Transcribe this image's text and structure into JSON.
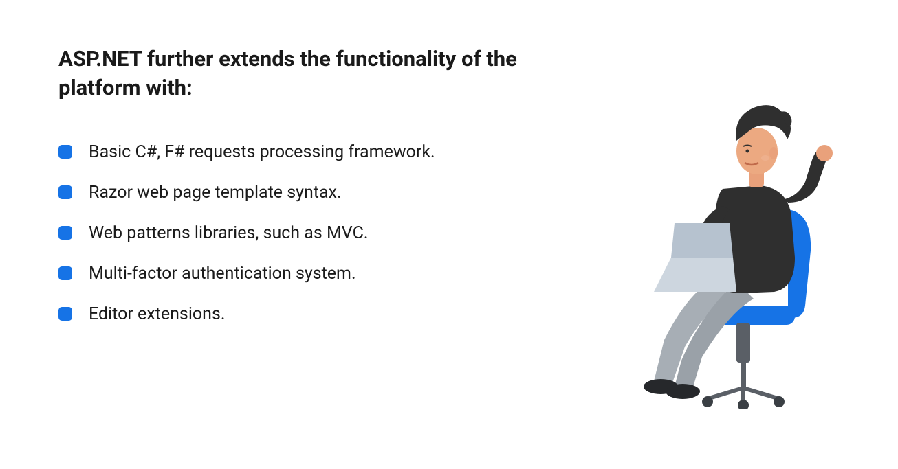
{
  "heading": "ASP.NET further extends the functionality of the platform with:",
  "items": [
    "Basic C#, F# requests processing framework.",
    "Razor web page template syntax.",
    "Web patterns libraries, such as MVC.",
    "Multi-factor authentication system.",
    "Editor extensions."
  ],
  "colors": {
    "bullet": "#1673e6",
    "text": "#1a1a1a"
  }
}
